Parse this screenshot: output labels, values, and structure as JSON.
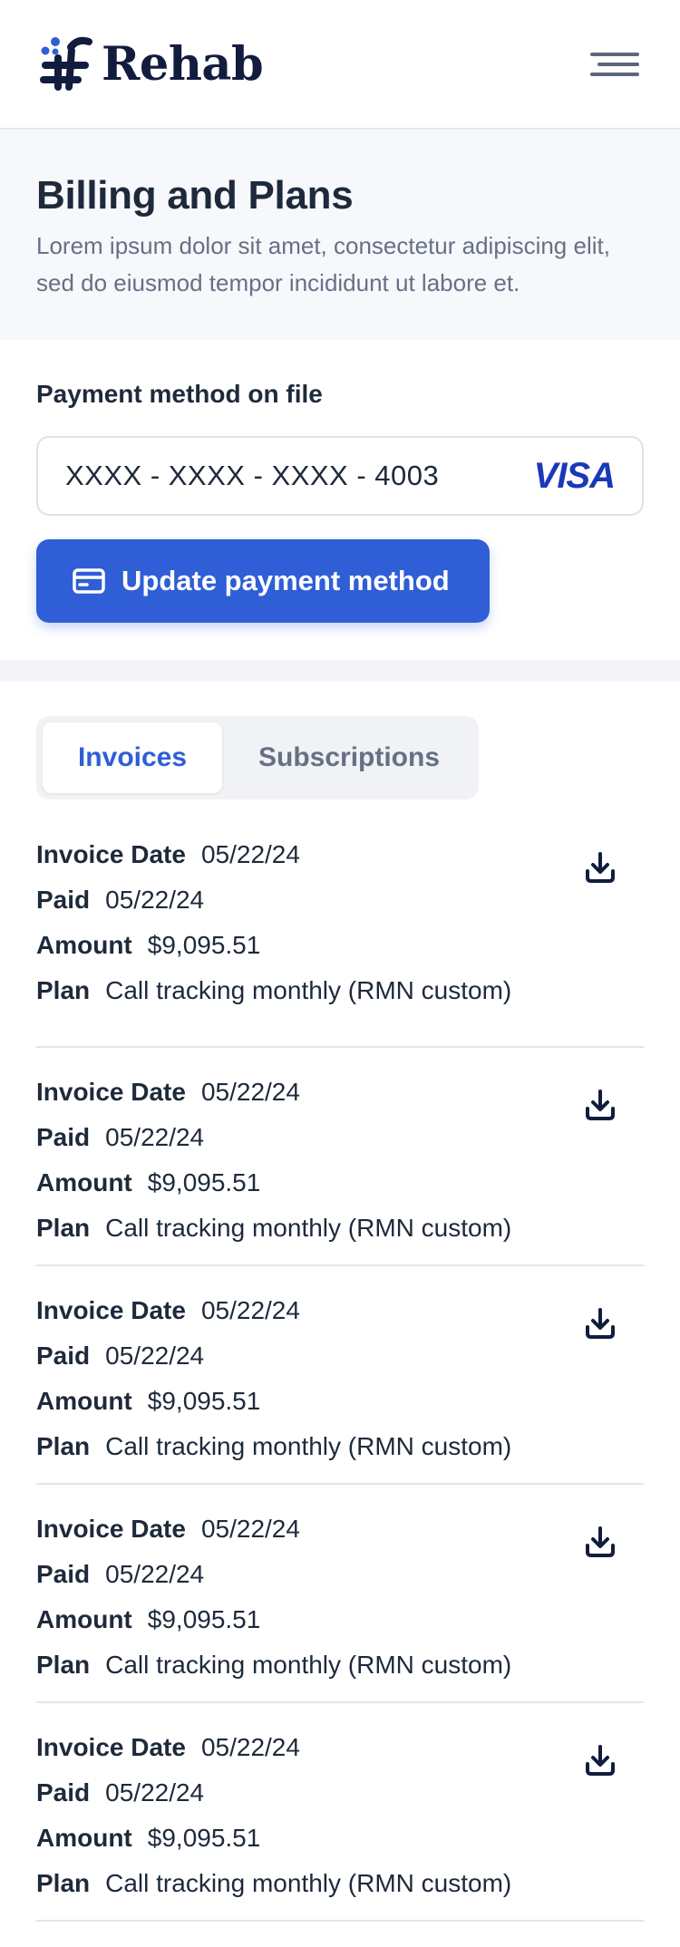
{
  "brand": {
    "name": "Rehab",
    "logo_icon": "rehab-logo-icon"
  },
  "header": {
    "menu_icon": "hamburger-menu-icon"
  },
  "page": {
    "title": "Billing and Plans",
    "subtitle": "Lorem ipsum dolor sit amet, consectetur adipiscing elit, sed do eiusmod tempor incididunt ut labore et."
  },
  "payment": {
    "label": "Payment method on file",
    "card_number": "XXXX - XXXX - XXXX - 4003",
    "card_brand": "VISA",
    "update_label": "Update payment method",
    "update_icon": "credit-card-icon"
  },
  "tabs": [
    {
      "label": "Invoices",
      "active": true
    },
    {
      "label": "Subscriptions",
      "active": false
    }
  ],
  "invoice_labels": {
    "date": "Invoice Date",
    "paid": "Paid",
    "amount": "Amount",
    "plan": "Plan"
  },
  "invoices": [
    {
      "date": "05/22/24",
      "paid": "05/22/24",
      "amount": "$9,095.51",
      "plan": "Call tracking monthly (RMN custom)"
    },
    {
      "date": "05/22/24",
      "paid": "05/22/24",
      "amount": "$9,095.51",
      "plan": "Call tracking monthly (RMN custom)"
    },
    {
      "date": "05/22/24",
      "paid": "05/22/24",
      "amount": "$9,095.51",
      "plan": "Call tracking monthly (RMN custom)"
    },
    {
      "date": "05/22/24",
      "paid": "05/22/24",
      "amount": "$9,095.51",
      "plan": "Call tracking monthly (RMN custom)"
    },
    {
      "date": "05/22/24",
      "paid": "05/22/24",
      "amount": "$9,095.51",
      "plan": "Call tracking monthly (RMN custom)"
    }
  ],
  "colors": {
    "brand_navy": "#121c3e",
    "primary_blue": "#2f5ed6",
    "visa_blue": "#1a39b8",
    "muted_text": "#667085"
  }
}
